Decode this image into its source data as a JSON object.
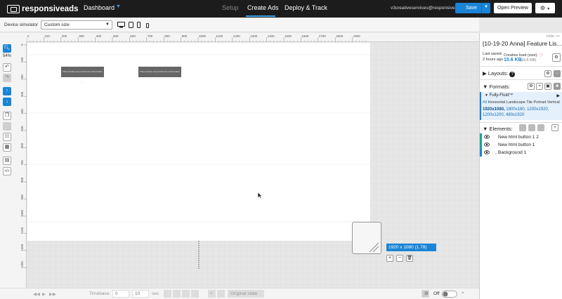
{
  "topbar": {
    "logo_part1": "responsive",
    "logo_part2": "ads",
    "dashboard_label": "Dashboard",
    "tabs": [
      {
        "label": "Setup"
      },
      {
        "label": "Create Ads"
      },
      {
        "label": "Deploy & Track"
      }
    ],
    "user_email": "v3creativeservices@responsivea...",
    "save_label": "Save",
    "preview_label": "Open Preview"
  },
  "device_bar": {
    "label": "Device simulator",
    "selected": "Custom size"
  },
  "ruler_top": {
    "ticks": [
      "0",
      "100",
      "200",
      "300",
      "400",
      "500",
      "600",
      "700",
      "800",
      "900",
      "1000",
      "1100",
      "1200",
      "1300",
      "1400",
      "1500",
      "1600",
      "1700",
      "1800",
      "1900"
    ]
  },
  "ruler_left": {
    "ticks": [
      "0",
      "100",
      "200",
      "300",
      "400",
      "500",
      "600",
      "700",
      "800",
      "900",
      "1000",
      "1100",
      "1200",
      "1300"
    ]
  },
  "toolbar": {
    "zoom": "54%"
  },
  "canvas": {
    "button_text_1": "This is button text put the text of the button here",
    "button_text_2": "This is button text put the text of the button here",
    "size_badge": "1920  x 1080   (1.78)"
  },
  "timeline": {
    "timebase_label": "Timebase:",
    "start": "0",
    "end": "10",
    "unit": "sec",
    "original_state": "Original state",
    "toggle_label": "Off"
  },
  "panel": {
    "hide": "Hide >>",
    "title": "[10-19-20 Anna] Feature Lis...",
    "last_saved_label": "Last saved:",
    "last_saved_value": "2 hours ago",
    "load_label": "Creative load (size):",
    "load_value": "15.6 KB",
    "load_sub": "(15.6 KB)",
    "layouts_label": "Layouts:",
    "formats_label": "Formats:",
    "format_name": "Fully-Fluid™",
    "format_tab_all": "All",
    "format_tabs_rest": "Horizontal Landscape Tile Portrait Vertical",
    "format_sizes_bold": "1920x1080,",
    "format_sizes_rest": "1800x180, 1200x1920, 1200x1200, 480x1920",
    "elements_label": "Elements:",
    "elements": [
      {
        "name": "New html button 1 2",
        "color": "#1aa39a"
      },
      {
        "name": "New html button 1",
        "color": "#1aa39a"
      },
      {
        "name": "Background 1",
        "color": "#1a84d6"
      }
    ]
  },
  "colors": {
    "accent": "#1a84d6",
    "topbar_bg": "#1c1c1c"
  }
}
